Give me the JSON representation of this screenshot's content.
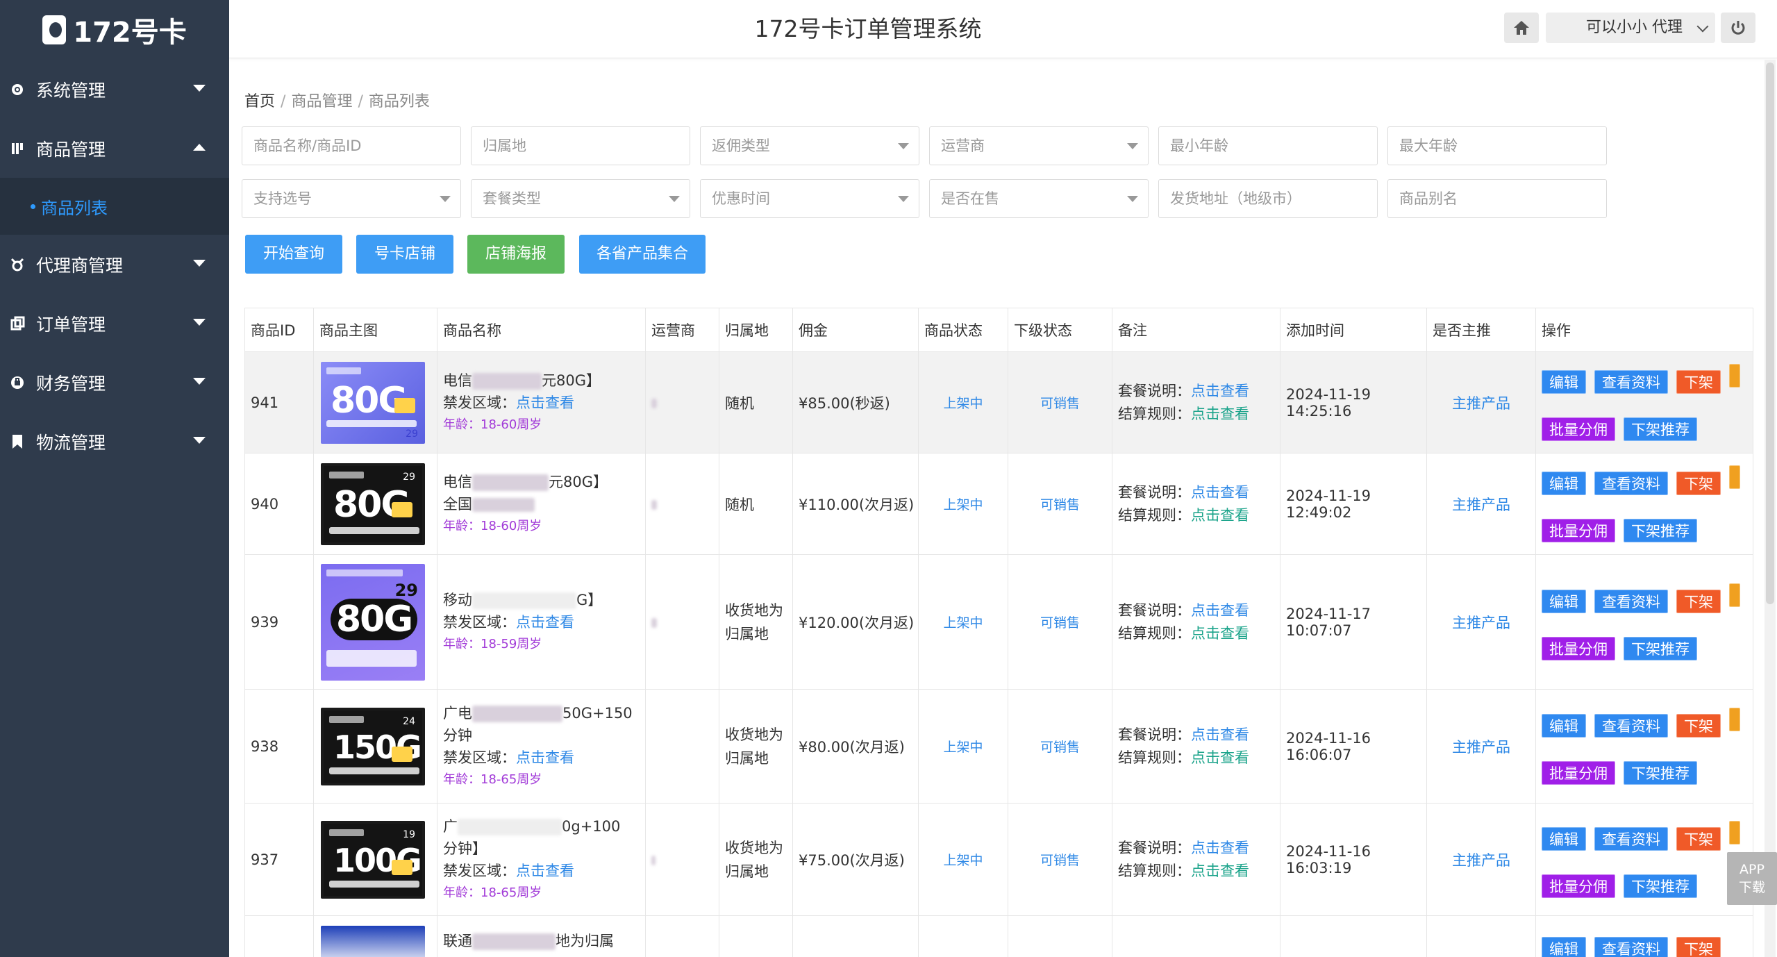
{
  "brand": {
    "logo_text": "172号卡"
  },
  "header": {
    "title": "172号卡订单管理系统",
    "agent_name": "可以小小 代理"
  },
  "sidebar": {
    "items": [
      {
        "label": "系统管理",
        "icon": "gear-icon",
        "expanded": false
      },
      {
        "label": "商品管理",
        "icon": "product-icon",
        "expanded": true
      },
      {
        "label": "代理商管理",
        "icon": "agent-icon",
        "expanded": false
      },
      {
        "label": "订单管理",
        "icon": "order-icon",
        "expanded": false
      },
      {
        "label": "财务管理",
        "icon": "finance-icon",
        "expanded": false
      },
      {
        "label": "物流管理",
        "icon": "logistics-icon",
        "expanded": false
      }
    ],
    "submenu_active": "商品列表"
  },
  "breadcrumb": {
    "home": "首页",
    "level1": "商品管理",
    "level2": "商品列表"
  },
  "filters": {
    "row1": [
      "商品名称/商品ID",
      "归属地",
      "返佣类型",
      "运营商",
      "最小年龄",
      "最大年龄"
    ],
    "row2": [
      "支持选号",
      "套餐类型",
      "优惠时间",
      "是否在售",
      "发货地址（地级市）",
      "商品别名"
    ]
  },
  "buttons": {
    "search": "开始查询",
    "shop": "号卡店铺",
    "poster": "店铺海报",
    "collection": "各省产品集合"
  },
  "table": {
    "headers": [
      "商品ID",
      "商品主图",
      "商品名称",
      "运营商",
      "归属地",
      "佣金",
      "商品状态",
      "下级状态",
      "备注",
      "添加时间",
      "是否主推",
      "操作"
    ],
    "rows": [
      {
        "id": "941",
        "thumb": {
          "big": "80G",
          "price": "29"
        },
        "name1a": "电信",
        "name1b": "元80G】",
        "name2": "禁发区域：",
        "name2_link": "点击查看",
        "age": "年龄：18-60周岁",
        "location": "随机",
        "commission": "¥85.00(秒返)",
        "status": "上架中",
        "sub_status": "可销售",
        "note1": "套餐说明：",
        "note1_link": "点击查看",
        "note2": "结算规则：",
        "note2_link": "点击查看",
        "time": "2024-11-19 14:25:16",
        "featured": "主推产品"
      },
      {
        "id": "940",
        "thumb": {
          "big": "80G",
          "price": "29"
        },
        "name1a": "电信",
        "name1b": "元80G】",
        "name2": "全国",
        "name2_link": "",
        "age": "年龄：18-60周岁",
        "location": "随机",
        "commission": "¥110.00(次月返)",
        "status": "上架中",
        "sub_status": "可销售",
        "note1": "套餐说明：",
        "note1_link": "点击查看",
        "note2": "结算规则：",
        "note2_link": "点击查看",
        "time": "2024-11-19 12:49:02",
        "featured": "主推产品"
      },
      {
        "id": "939",
        "thumb": {
          "big": "80G",
          "price": "29"
        },
        "name1a": "移动",
        "name1b": "G】",
        "name2": "禁发区域：",
        "name2_link": "点击查看",
        "age": "年龄：18-59周岁",
        "location": "收货地为归属地",
        "commission": "¥120.00(次月返)",
        "status": "上架中",
        "sub_status": "可销售",
        "note1": "套餐说明：",
        "note1_link": "点击查看",
        "note2": "结算规则：",
        "note2_link": "点击查看",
        "time": "2024-11-17 10:07:07",
        "featured": "主推产品"
      },
      {
        "id": "938",
        "thumb": {
          "big": "150G",
          "price": "24"
        },
        "name1a": "广电",
        "name1b": "50G+150",
        "name1c": "分钟",
        "name2": "禁发区域：",
        "name2_link": "点击查看",
        "age": "年龄：18-65周岁",
        "location": "收货地为归属地",
        "commission": "¥80.00(次月返)",
        "status": "上架中",
        "sub_status": "可销售",
        "note1": "套餐说明：",
        "note1_link": "点击查看",
        "note2": "结算规则：",
        "note2_link": "点击查看",
        "time": "2024-11-16 16:06:07",
        "featured": "主推产品"
      },
      {
        "id": "937",
        "thumb": {
          "big": "100G",
          "price": "19"
        },
        "name1a": "广",
        "name1b": "0g+100",
        "name1c": "分钟】",
        "name2": "禁发区域：",
        "name2_link": "点击查看",
        "age": "年龄：18-65周岁",
        "location": "收货地为归属地",
        "commission": "¥75.00(次月返)",
        "status": "上架中",
        "sub_status": "可销售",
        "note1": "套餐说明：",
        "note1_link": "点击查看",
        "note2": "结算规则：",
        "note2_link": "点击查看",
        "time": "2024-11-16 16:03:19",
        "featured": "主推产品"
      },
      {
        "name1a": "联通",
        "name1b": "地为归属"
      }
    ],
    "ops": {
      "edit": "编辑",
      "view": "查看资料",
      "offline": "下架",
      "batch": "批量分佣",
      "unfeature": "下架推荐"
    }
  },
  "app_badge": {
    "line1": "APP",
    "line2": "下载"
  },
  "colors": {
    "sidebar_bg": "#2f3b4c",
    "accent_blue": "#3e9df5",
    "green": "#5cb85c",
    "red": "#f05a28",
    "purple": "#a01fe8",
    "orange": "#f0a020"
  }
}
